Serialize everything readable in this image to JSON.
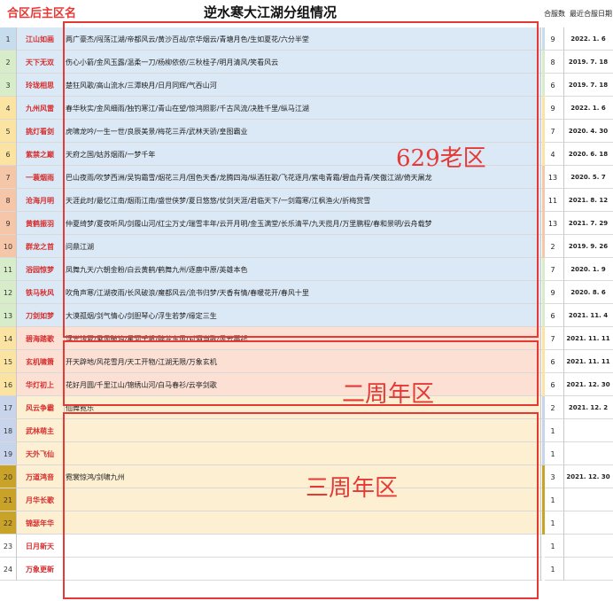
{
  "header": {
    "region_label": "合区后主区名",
    "title": "逆水寒大江湖分组情况",
    "col_count": "合服数",
    "col_date": "最近合服日期"
  },
  "zones": {
    "old": "629老区",
    "second": "二周年区",
    "third": "三周年区"
  },
  "rows": [
    {
      "no": "1",
      "name": "江山如画",
      "members": "两广豪杰/闯荡江湖/帝都风云/黄沙百战/京华烟云/青塘月色/生如夏花/六分半堂",
      "count": "9",
      "date": "2022. 1. 6",
      "bg": "#dbe8f5",
      "stripe": "#c7dced"
    },
    {
      "no": "2",
      "name": "天下无双",
      "members": "伤心小箭/金风玉露/温柔一刀/杨柳依依/三秋桂子/明月清风/笑看风云",
      "count": "8",
      "date": "2019. 7. 18",
      "bg": "#dbe8f5",
      "stripe": "#d7ecc9"
    },
    {
      "no": "3",
      "name": "玲珑相思",
      "members": "楚狂风歌/高山流水/三潭映月/日月同辉/气吞山河",
      "count": "6",
      "date": "2019. 7. 18",
      "bg": "#dbe8f5",
      "stripe": "#d7ecc9"
    },
    {
      "no": "4",
      "name": "九州风雷",
      "members": "春华秋实/金风细雨/独钓寒江/青山在望/惊鸿照影/千古风流/决胜千里/纵马江湖",
      "count": "9",
      "date": "2022. 1. 6",
      "bg": "#dbe8f5",
      "stripe": "#fbe3a1"
    },
    {
      "no": "5",
      "name": "挑灯看剑",
      "members": "虎啸龙吟/一生一世/良辰美景/梅花三弄/武林天骄/皇图霸业",
      "count": "7",
      "date": "2020. 4. 30",
      "bg": "#dbe8f5",
      "stripe": "#fbe3a1"
    },
    {
      "no": "6",
      "name": "紫禁之巅",
      "members": "天府之国/姑苏烟雨/一梦千年",
      "count": "4",
      "date": "2020. 6. 18",
      "bg": "#dbe8f5",
      "stripe": "#fbe3a1"
    },
    {
      "no": "7",
      "name": "一蓑烟雨",
      "members": "巴山夜雨/吹梦西洲/吴钩霜雪/烟花三月/国色天香/龙腾四海/纵酒狂歌/飞花逐月/紫电青霜/碧血丹青/笑傲江湖/倚天屠龙",
      "count": "13",
      "date": "2020. 5. 7",
      "bg": "#dbe8f5",
      "stripe": "#f5c6a8"
    },
    {
      "no": "8",
      "name": "沧海月明",
      "members": "天涯此时/最忆江南/烟雨江南/盛世侠梦/夏日悠悠/仗剑天涯/君临天下/一剑霜寒/江枫渔火/折梅赏雪",
      "count": "11",
      "date": "2021. 8. 12",
      "bg": "#dbe8f5",
      "stripe": "#f5c6a8"
    },
    {
      "no": "9",
      "name": "黄鹤振羽",
      "members": "仲夏绮梦/夏夜听风/剑履山河/红尘万丈/瑞雪丰年/云开月明/金玉满堂/长乐清平/九天揽月/万里鹏程/春和景明/云舟载梦",
      "count": "13",
      "date": "2021. 7. 29",
      "bg": "#dbe8f5",
      "stripe": "#f5c6a8"
    },
    {
      "no": "10",
      "name": "群龙之首",
      "members": "问鼎江湖",
      "count": "2",
      "date": "2019. 9. 26",
      "bg": "#dbe8f5",
      "stripe": "#f5c6a8"
    },
    {
      "no": "11",
      "name": "浴园惊梦",
      "members": "凤舞九天/六朝金粉/白云黄鹤/鹤舞九州/逐鹿中原/英雄本色",
      "count": "7",
      "date": "2020. 1. 9",
      "bg": "#dbe8f5",
      "stripe": "#d7ecc9"
    },
    {
      "no": "12",
      "name": "铁马秋风",
      "members": "吹角声寒/江湖夜雨/长风破浪/魔都风云/流书归梦/天香有情/春暖花开/春风十里",
      "count": "9",
      "date": "2020. 8. 6",
      "bg": "#dbe8f5",
      "stripe": "#d7ecc9"
    },
    {
      "no": "13",
      "name": "刀剑如梦",
      "members": "大漠孤烟/剑气情心/剑胆琴心/浮生若梦/缘定三生",
      "count": "6",
      "date": "2021. 11. 4",
      "bg": "#dbe8f5",
      "stripe": "#d7ecc9"
    },
    {
      "no": "14",
      "name": "碧海踏歌",
      "members": "浮光浅夏/乘风破浪/星河千帆/醉梦东风/对酒当歌/风云再起",
      "count": "7",
      "date": "2021. 11. 11",
      "bg": "#fbe0d3",
      "stripe": "#fbe3a1"
    },
    {
      "no": "15",
      "name": "玄机啸箫",
      "members": "开天辟地/风花雪月/天工开物/江湖无限/万象玄机",
      "count": "6",
      "date": "2021. 11. 11",
      "bg": "#fbe0d3",
      "stripe": "#fbe3a1"
    },
    {
      "no": "16",
      "name": "华灯初上",
      "members": "花好月圆/千里江山/锦绣山河/白马春衫/云亭剑歌",
      "count": "6",
      "date": "2021. 12. 30",
      "bg": "#fbe0d3",
      "stripe": "#fbe3a1"
    },
    {
      "no": "17",
      "name": "风云争霸",
      "members": "仙舞霓乐",
      "count": "2",
      "date": "2021. 12. 2",
      "bg": "#fdf0d2",
      "stripe": "#c7d4ec"
    },
    {
      "no": "18",
      "name": "武林萌主",
      "members": "",
      "count": "1",
      "date": "",
      "bg": "#fdf0d2",
      "stripe": "#c7d4ec"
    },
    {
      "no": "19",
      "name": "天外飞仙",
      "members": "",
      "count": "1",
      "date": "",
      "bg": "#fdf0d2",
      "stripe": "#c7d4ec"
    },
    {
      "no": "20",
      "name": "万道鸿音",
      "members": "霓裳惊鸿/剑啸九州",
      "count": "3",
      "date": "2021. 12. 30",
      "bg": "#fdf0d2",
      "stripe": "#c9a228"
    },
    {
      "no": "21",
      "name": "月华长歌",
      "members": "",
      "count": "1",
      "date": "",
      "bg": "#fdf0d2",
      "stripe": "#c9a228"
    },
    {
      "no": "22",
      "name": "锦瑟年华",
      "members": "",
      "count": "1",
      "date": "",
      "bg": "#fdf0d2",
      "stripe": "#c9a228"
    },
    {
      "no": "23",
      "name": "日月新天",
      "members": "",
      "count": "1",
      "date": "",
      "bg": "#ffffff",
      "stripe": "#ffffff"
    },
    {
      "no": "24",
      "name": "万象更新",
      "members": "",
      "count": "1",
      "date": "",
      "bg": "#ffffff",
      "stripe": "#ffffff"
    }
  ],
  "colors": {
    "accent_red": "#e53935",
    "old_zone_bg": "#dbe8f5",
    "second_zone_bg": "#fbe0d3",
    "third_zone_bg": "#fdf0d2"
  }
}
